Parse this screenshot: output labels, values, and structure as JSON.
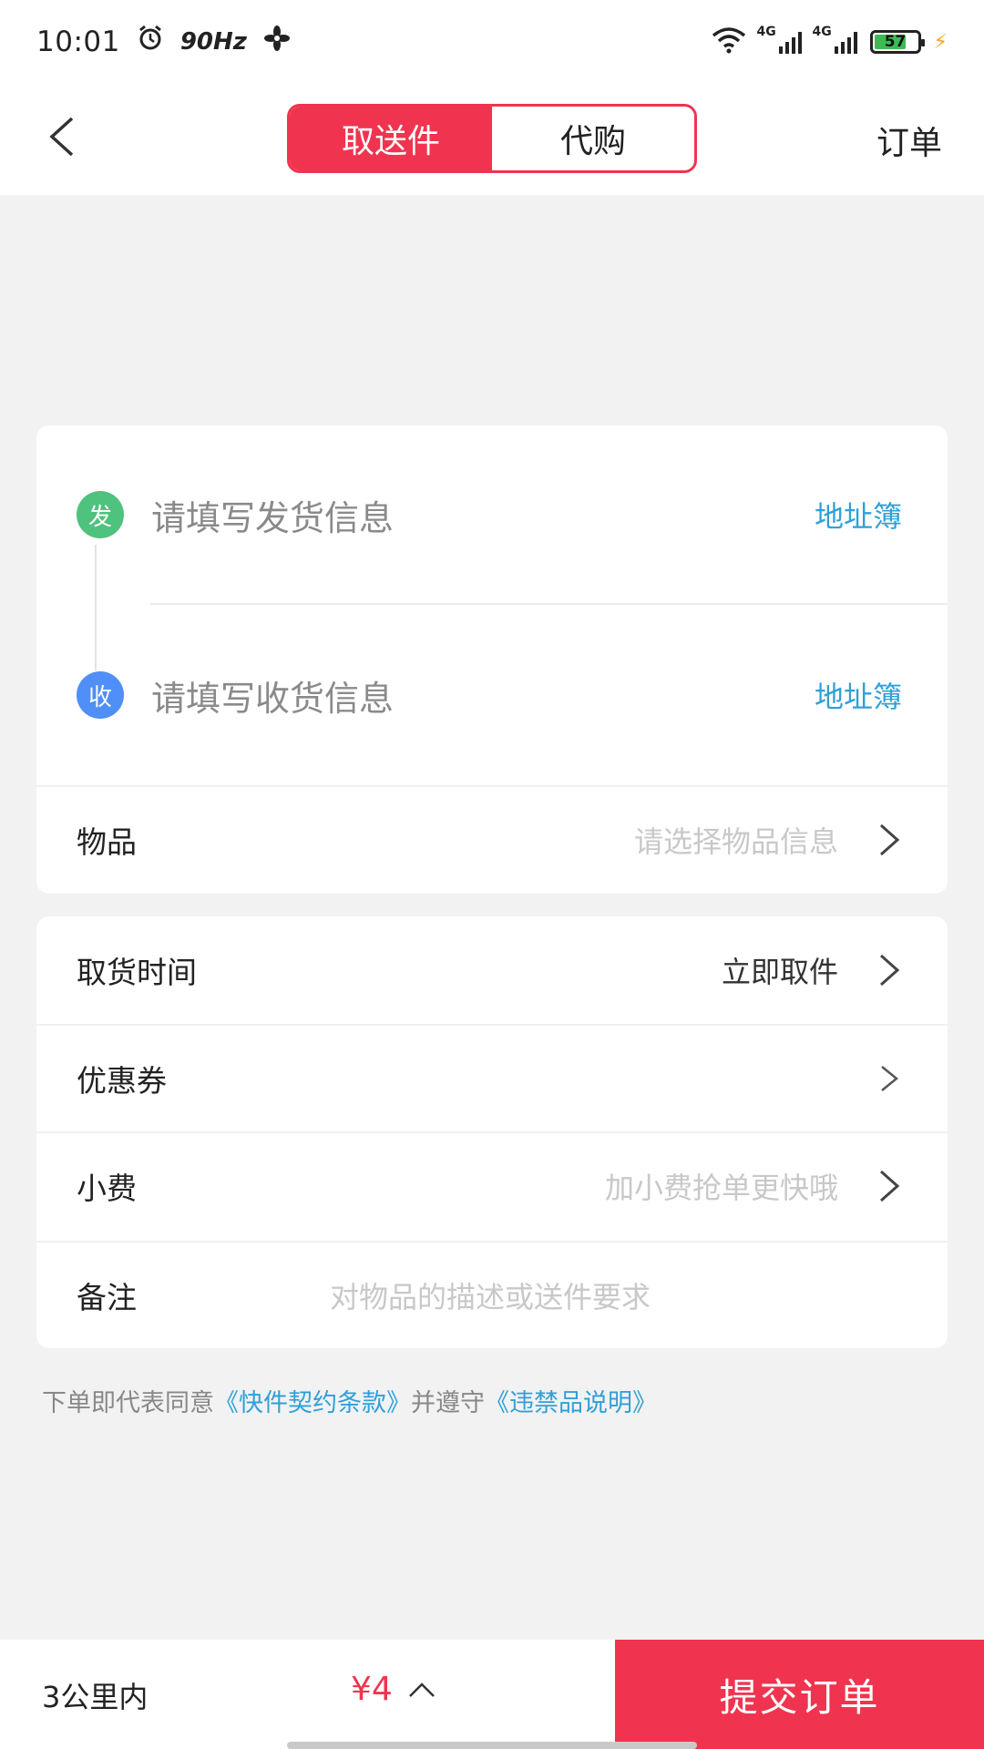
{
  "status_bar": {
    "time": "10:01",
    "refresh_rate": "90Hz",
    "network_1": "4G",
    "network_2": "4G",
    "battery": "57"
  },
  "header": {
    "tabs": [
      {
        "label": "取送件",
        "active": true
      },
      {
        "label": "代购",
        "active": false
      }
    ],
    "order_label": "订单"
  },
  "address": {
    "send": {
      "badge": "发",
      "placeholder": "请填写发货信息",
      "book": "地址簿"
    },
    "receive": {
      "badge": "收",
      "placeholder": "请填写收货信息",
      "book": "地址簿"
    }
  },
  "form": {
    "item": {
      "label": "物品",
      "placeholder": "请选择物品信息"
    },
    "pickup_time": {
      "label": "取货时间",
      "value": "立即取件"
    },
    "coupon": {
      "label": "优惠券"
    },
    "tip": {
      "label": "小费",
      "placeholder": "加小费抢单更快哦"
    },
    "note": {
      "label": "备注",
      "placeholder": "对物品的描述或送件要求"
    }
  },
  "terms": {
    "prefix": "下单即代表同意",
    "link1": "《快件契约条款》",
    "middle": "并遵守",
    "link2": "《违禁品说明》"
  },
  "bottom": {
    "distance": "3公里内",
    "price": "¥4",
    "submit": "提交订单"
  },
  "colors": {
    "accent": "#f0344f",
    "link": "#2fa0d8",
    "send_badge": "#4fc27d",
    "receive_badge": "#4f8ff7"
  }
}
